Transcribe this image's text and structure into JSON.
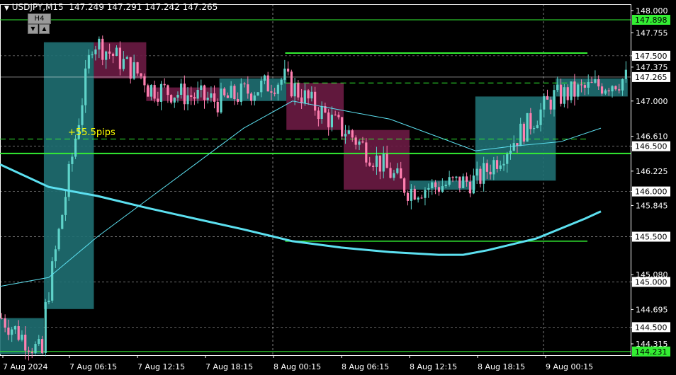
{
  "header": {
    "caret": "▼",
    "symbol": "USDJPY",
    "timeframe": "M15",
    "ohlc": "147.249 147.291 147.242 147.265"
  },
  "timeframe_box": {
    "label": "H4",
    "down": "▼",
    "up": "▲"
  },
  "colors": {
    "background": "#000000",
    "frame": "#ffffff",
    "bull": "#5fd3c9",
    "bear": "#ff7fb0",
    "box_bull": "#1f6f72",
    "box_bear": "#6b1b44",
    "level_line": "#33ee33",
    "ma_slow": "#5ce0f0",
    "ma_fast": "#5ce0f0",
    "grid": "#ffffff",
    "current_price": "#ffffff",
    "annotation": "#ffff00"
  },
  "chart_data": {
    "type": "candlestick",
    "y_ticks": [
      "148.000",
      "147.755",
      "147.500",
      "147.375",
      "147.000",
      "146.610",
      "146.500",
      "146.225",
      "146.000",
      "145.845",
      "145.500",
      "145.080",
      "145.000",
      "144.695",
      "144.500",
      "144.315"
    ],
    "y_range": [
      144.19,
      148.07
    ],
    "x_ticks": [
      "7 Aug 2024",
      "7 Aug 06:15",
      "7 Aug 12:15",
      "7 Aug 18:15",
      "8 Aug 00:15",
      "8 Aug 06:15",
      "8 Aug 12:15",
      "8 Aug 18:15",
      "9 Aug 00:15"
    ],
    "current_price": "147.265",
    "level_labels": [
      {
        "price": "147.898",
        "value": 147.898
      },
      {
        "price": "144.231",
        "value": 144.231
      }
    ],
    "highlighted_prices": [
      "147.500",
      "146.500",
      "146.000",
      "145.500",
      "145.000",
      "144.500"
    ],
    "annotation": "+55.5pips",
    "day_separators": [
      "8 Aug 00:15",
      "9 Aug 00:15"
    ],
    "h4_boxes": [
      {
        "from": 0,
        "to": 3.6,
        "open": 144.6,
        "close": 144.2,
        "dir": "bull"
      },
      {
        "from": 3.6,
        "to": 7.7,
        "open": 144.7,
        "close": 147.65,
        "dir": "bull"
      },
      {
        "from": 7.7,
        "to": 12.0,
        "open": 147.65,
        "close": 147.25,
        "dir": "bear"
      },
      {
        "from": 12.0,
        "to": 18.0,
        "open": 147.15,
        "close": 147.0,
        "dir": "bear"
      },
      {
        "from": 18.0,
        "to": 23.5,
        "open": 147.0,
        "close": 147.25,
        "dir": "bull"
      },
      {
        "from": 23.5,
        "to": 28.2,
        "open": 147.2,
        "close": 146.68,
        "dir": "bear"
      },
      {
        "from": 28.2,
        "to": 33.6,
        "open": 146.68,
        "close": 146.02,
        "dir": "bear"
      },
      {
        "from": 33.6,
        "to": 39.0,
        "open": 146.02,
        "close": 146.12,
        "dir": "bull"
      },
      {
        "from": 39.0,
        "to": 45.6,
        "open": 146.12,
        "close": 147.05,
        "dir": "bull"
      },
      {
        "from": 45.6,
        "to": 51.5,
        "open": 147.05,
        "close": 147.25,
        "dir": "bull"
      }
    ],
    "horizontal_levels": [
      {
        "value": 147.898,
        "from": 0,
        "to": 55,
        "width": 1
      },
      {
        "value": 147.53,
        "from": 23.4,
        "to": 48.2,
        "width": 2
      },
      {
        "value": 146.42,
        "from": 0,
        "to": 55,
        "width": 2
      },
      {
        "value": 145.45,
        "from": 23.4,
        "to": 48.2,
        "width": 1.5
      },
      {
        "value": 144.231,
        "from": 0,
        "to": 55,
        "width": 1
      }
    ],
    "dashed_levels": [
      {
        "value": 147.2,
        "from": 23.4,
        "to": 48.2
      },
      {
        "value": 146.58,
        "from": 0,
        "to": 48.2
      }
    ],
    "ma_slow": [
      [
        0,
        146.3
      ],
      [
        4,
        146.05
      ],
      [
        8,
        145.95
      ],
      [
        12,
        145.82
      ],
      [
        16,
        145.7
      ],
      [
        20,
        145.58
      ],
      [
        24,
        145.45
      ],
      [
        28,
        145.38
      ],
      [
        32,
        145.33
      ],
      [
        36,
        145.3
      ],
      [
        38,
        145.3
      ],
      [
        40,
        145.35
      ],
      [
        44,
        145.48
      ],
      [
        48,
        145.7
      ],
      [
        49.3,
        145.78
      ]
    ],
    "ma_fast": [
      [
        0,
        144.95
      ],
      [
        4,
        145.05
      ],
      [
        8,
        145.5
      ],
      [
        12,
        145.9
      ],
      [
        16,
        146.3
      ],
      [
        20,
        146.7
      ],
      [
        24,
        147.0
      ],
      [
        28,
        146.9
      ],
      [
        32,
        146.8
      ],
      [
        36,
        146.6
      ],
      [
        39,
        146.45
      ],
      [
        42,
        146.5
      ],
      [
        46,
        146.55
      ],
      [
        49.3,
        146.7
      ]
    ],
    "candles_bull_hint": "close >= open"
  },
  "x_slots": 56
}
